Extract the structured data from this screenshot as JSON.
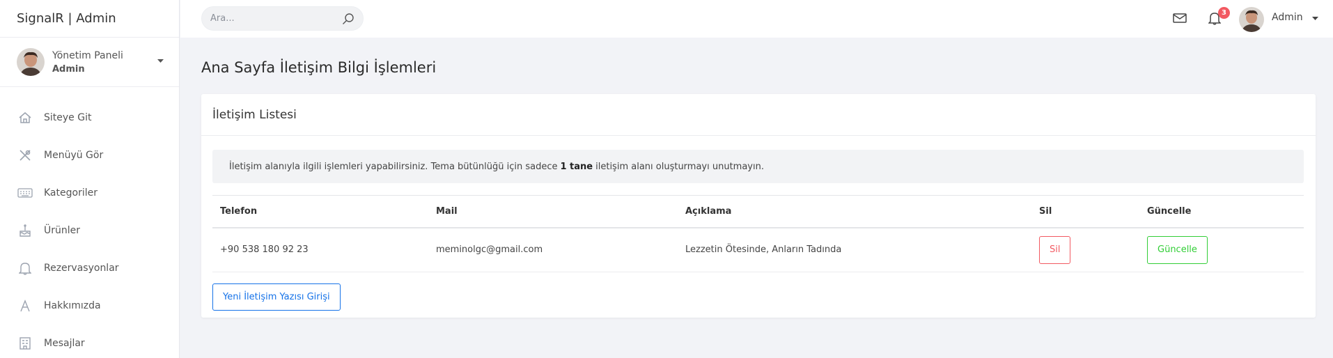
{
  "brand": "SignalR | Admin",
  "user_panel": {
    "title": "Yönetim Paneli",
    "role": "Admin"
  },
  "nav": [
    {
      "label": "Siteye Git",
      "icon": "home-icon"
    },
    {
      "label": "Menüyü Gör",
      "icon": "utensils-icon"
    },
    {
      "label": "Kategoriler",
      "icon": "keyboard-icon"
    },
    {
      "label": "Ürünler",
      "icon": "cake-icon"
    },
    {
      "label": "Rezervasyonlar",
      "icon": "bell-icon"
    },
    {
      "label": "Hakkımızda",
      "icon": "font-icon"
    },
    {
      "label": "Mesajlar",
      "icon": "building-icon"
    }
  ],
  "topbar": {
    "search_placeholder": "Ara...",
    "notification_count": "3",
    "user_name": "Admin"
  },
  "page": {
    "title": "Ana Sayfa İletişim Bilgi İşlemleri",
    "card_title": "İletişim Listesi",
    "alert_prefix": "İletişim alanıyla ilgili işlemleri yapabilirsiniz. Tema bütünlüğü için sadece",
    "alert_bold": "1 tane",
    "alert_suffix": "iletişim alanı oluşturmayı unutmayın.",
    "new_button": "Yeni İletişim Yazısı Girişi"
  },
  "table": {
    "headers": [
      "Telefon",
      "Mail",
      "Açıklama",
      "Sil",
      "Güncelle"
    ],
    "rows": [
      {
        "phone": "+90 538 180 92 23",
        "mail": "meminolgc@gmail.com",
        "desc": "Lezzetin Ötesinde, Anların Tadında",
        "delete": "Sil",
        "update": "Güncelle"
      }
    ]
  },
  "colors": {
    "danger": "#f25961",
    "success": "#31ce36",
    "primary": "#1572e8"
  }
}
